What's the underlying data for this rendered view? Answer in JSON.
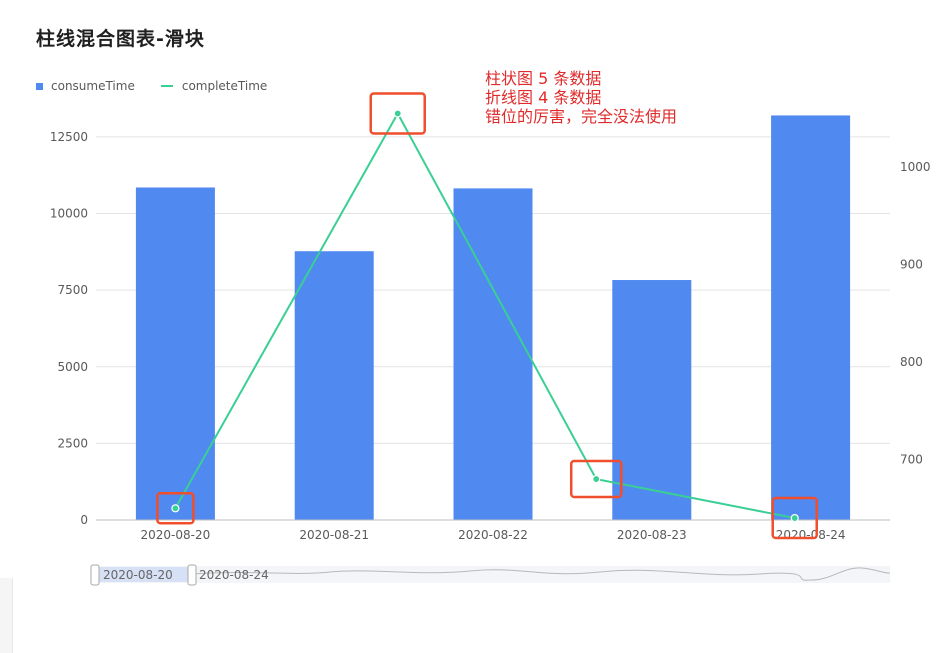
{
  "page": {
    "title": "柱线混合图表-滑块"
  },
  "annotation": {
    "line1": "柱状图 5 条数据",
    "line2": "折线图 4 条数据",
    "line3": "错位的厉害，完全没法使用"
  },
  "slider": {
    "start_label": "2020-08-20",
    "end_label": "2020-08-24"
  },
  "colors": {
    "bar": "#5089f0",
    "line": "#3acf95",
    "highlight": "#f04e2c",
    "annotation": "#e02b2b"
  },
  "chart_data": {
    "type": "bar",
    "title": "柱线混合图表-滑块",
    "categories": [
      "2020-08-20",
      "2020-08-21",
      "2020-08-22",
      "2020-08-23",
      "2020-08-24"
    ],
    "series": [
      {
        "name": "consumeTime",
        "type": "bar",
        "axis": "left",
        "values": [
          10850,
          8770,
          10820,
          7830,
          13200
        ]
      },
      {
        "name": "completeTime",
        "type": "line",
        "axis": "right",
        "x": [
          "2020-08-20",
          "2020-08-21",
          "2020-08-23",
          "2020-08-24"
        ],
        "values": [
          650,
          1055,
          680,
          640
        ]
      }
    ],
    "y_left": {
      "ticks": [
        0,
        2500,
        5000,
        7500,
        10000,
        12500
      ],
      "range": [
        0,
        13900
      ]
    },
    "y_right": {
      "ticks": [
        700,
        800,
        900,
        1000
      ],
      "range": [
        638,
        1075
      ]
    },
    "grid": true,
    "legend": "top-left"
  }
}
